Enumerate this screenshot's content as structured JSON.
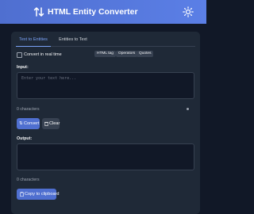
{
  "header": {
    "title": "HTML Entity Converter",
    "logo_icon": "arrows-swap-icon",
    "theme_icon": "sun-icon",
    "gradient_start": "#4f6fd0",
    "gradient_end": "#5b7fe6"
  },
  "tabs": [
    {
      "label": "Text to Entities",
      "active": true
    },
    {
      "label": "Entities to Text",
      "active": false
    }
  ],
  "options": {
    "realtime_label": "Convert in real time",
    "realtime_checked": false,
    "chips": [
      "HTML tag",
      "Operators",
      "Quotes"
    ]
  },
  "input": {
    "label": "Input:",
    "placeholder": "Enter your text here...",
    "char_count": "0 characters"
  },
  "actions": {
    "convert_label": "Convert",
    "convert_icon": "exchange-icon",
    "clear_label": "Clear",
    "clear_icon": "trash-icon"
  },
  "output": {
    "label": "Output:",
    "char_count": "0 characters"
  },
  "copy": {
    "label": "Copy to clipboard",
    "icon": "clipboard-icon"
  },
  "colors": {
    "accent": "#4f6fd0",
    "background": "#111827",
    "card": "#1f2937",
    "active_tab": "#7aa2f7"
  }
}
